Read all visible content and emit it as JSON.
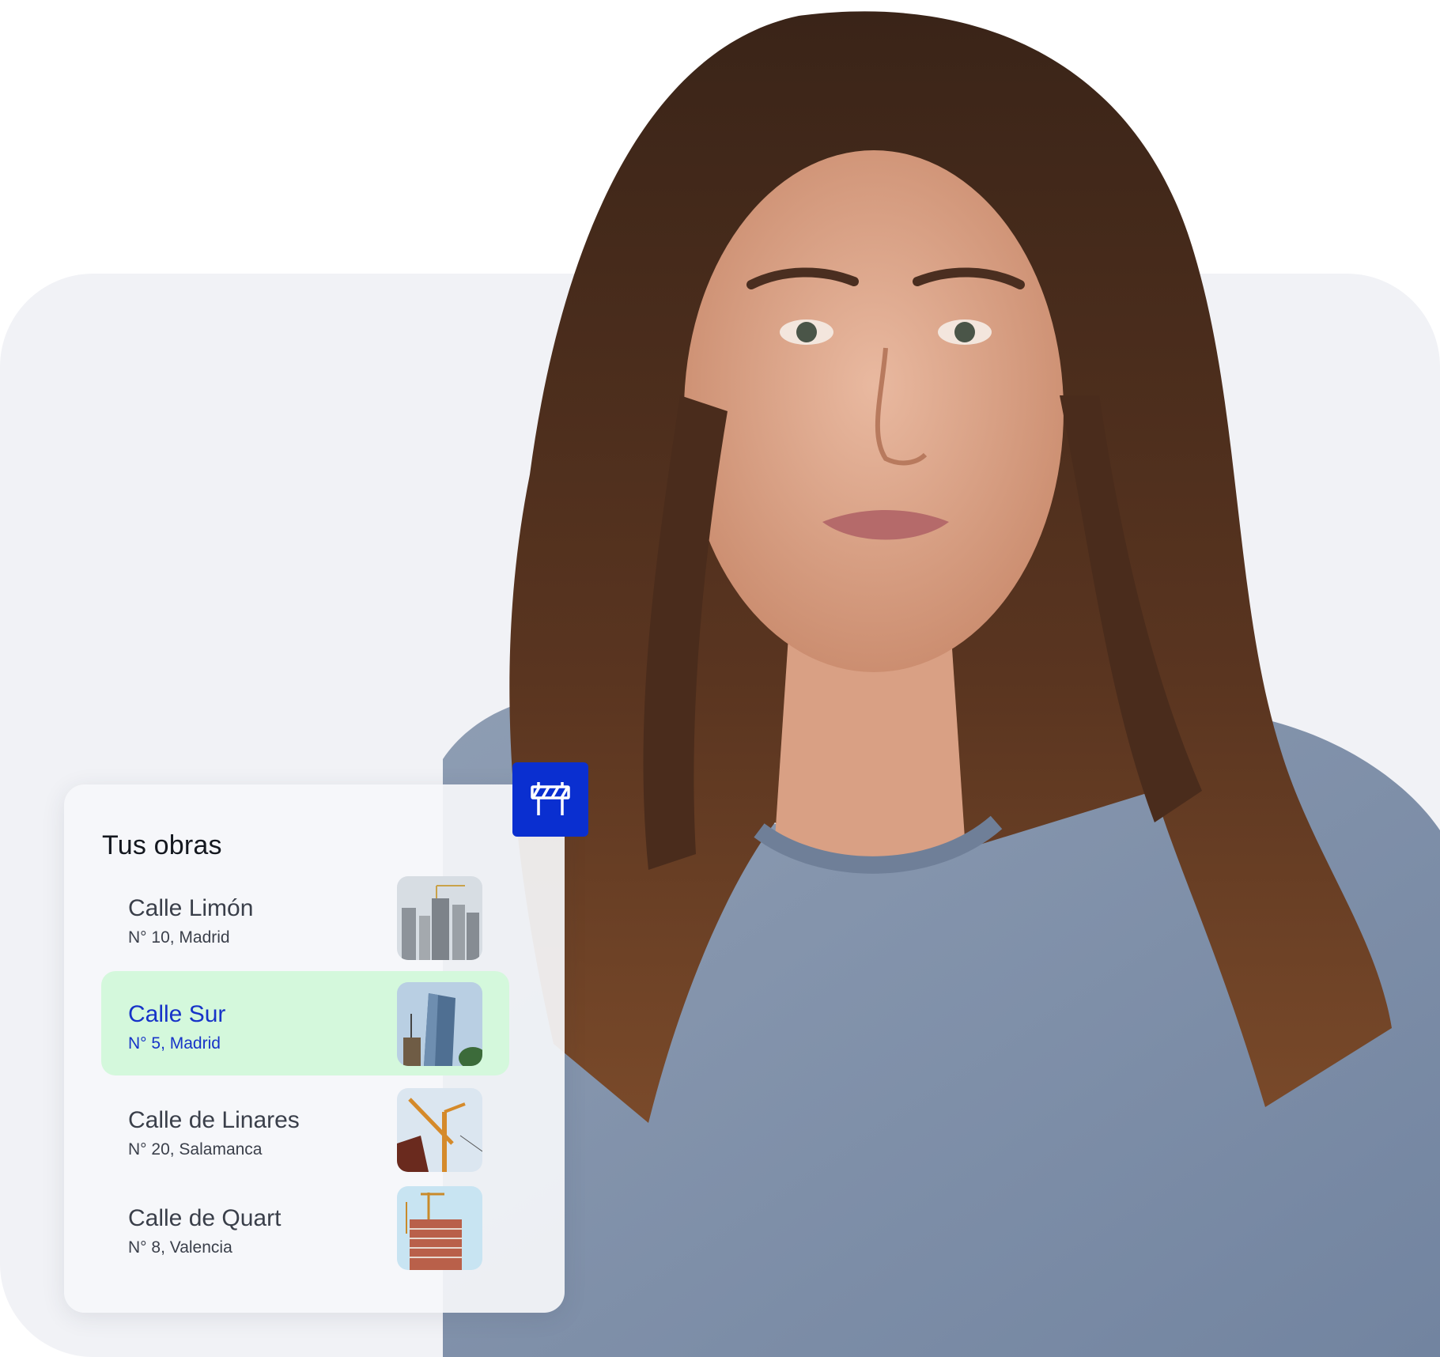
{
  "card": {
    "title": "Tus obras",
    "badge_icon": "barrier-icon",
    "items": [
      {
        "name": "Calle Limón",
        "address": "N° 10, Madrid",
        "selected": false,
        "thumb": "skyscrapers-photo"
      },
      {
        "name": "Calle Sur",
        "address": "N° 5, Madrid",
        "selected": true,
        "thumb": "glass-tower-photo"
      },
      {
        "name": "Calle de Linares",
        "address": "N° 20, Salamanca",
        "selected": false,
        "thumb": "crane-photo"
      },
      {
        "name": "Calle de Quart",
        "address": "N° 8, Valencia",
        "selected": false,
        "thumb": "construction-tower-photo"
      }
    ]
  },
  "colors": {
    "accent": "#0a2fd0",
    "selected_bg": "#d4f8dc",
    "selected_text": "#1733c8",
    "panel_bg": "#f1f2f6"
  }
}
